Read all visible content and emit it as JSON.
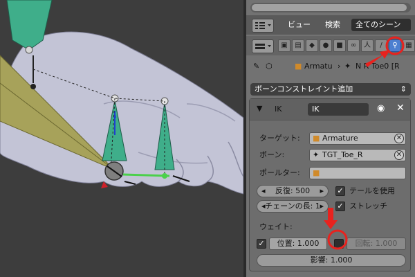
{
  "header": {
    "view_menu": "ビュー",
    "search_menu": "検索",
    "scene_dropdown": "全てのシーン"
  },
  "breadcrumb": {
    "armature": "Armatu",
    "bone": "N    R Toe0 [R"
  },
  "add_constraint": "ボーンコンストレイント追加",
  "constraint": {
    "type_label": "IK",
    "name_value": "IK",
    "target_label": "ターゲット:",
    "target_value": "Armature",
    "bone_label": "ボーン:",
    "bone_value": "TGT_Toe_R",
    "pole_label": "ポールター:",
    "iterations_label": "反復: 500",
    "use_tail_label": "テールを使用",
    "chain_length_label": "チェーンの長: 1",
    "stretch_label": "ストレッチ",
    "weight_heading": "ウェイト:",
    "position_weight": "位置: 1.000",
    "rotation_weight": "回転: 1.000",
    "influence": "影響: 1.000",
    "use_tail_checked": true,
    "stretch_checked": true,
    "position_checked": true,
    "rotation_checked": false
  },
  "colors": {
    "panel_bg": "#727272",
    "active_tab": "#4d7fd0",
    "annotation_red": "#e8221e",
    "bone_green": "#3fae8a",
    "viewport_bg": "#3d3d3d"
  }
}
